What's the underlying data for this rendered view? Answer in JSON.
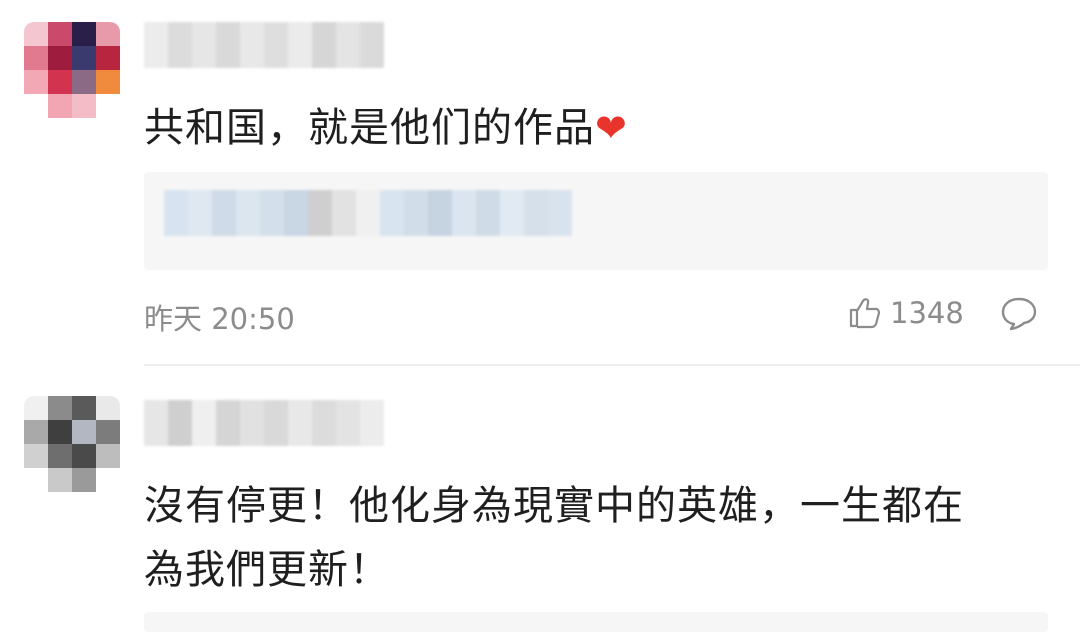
{
  "comments": [
    {
      "text": "共和国，就是他们的作品",
      "emoji": "❤",
      "timestamp": "昨天 20:50",
      "like_count": "1348"
    },
    {
      "text_line1": "沒有停更！他化身為現實中的英雄，一生都在",
      "text_line2": "為我們更新！"
    }
  ]
}
